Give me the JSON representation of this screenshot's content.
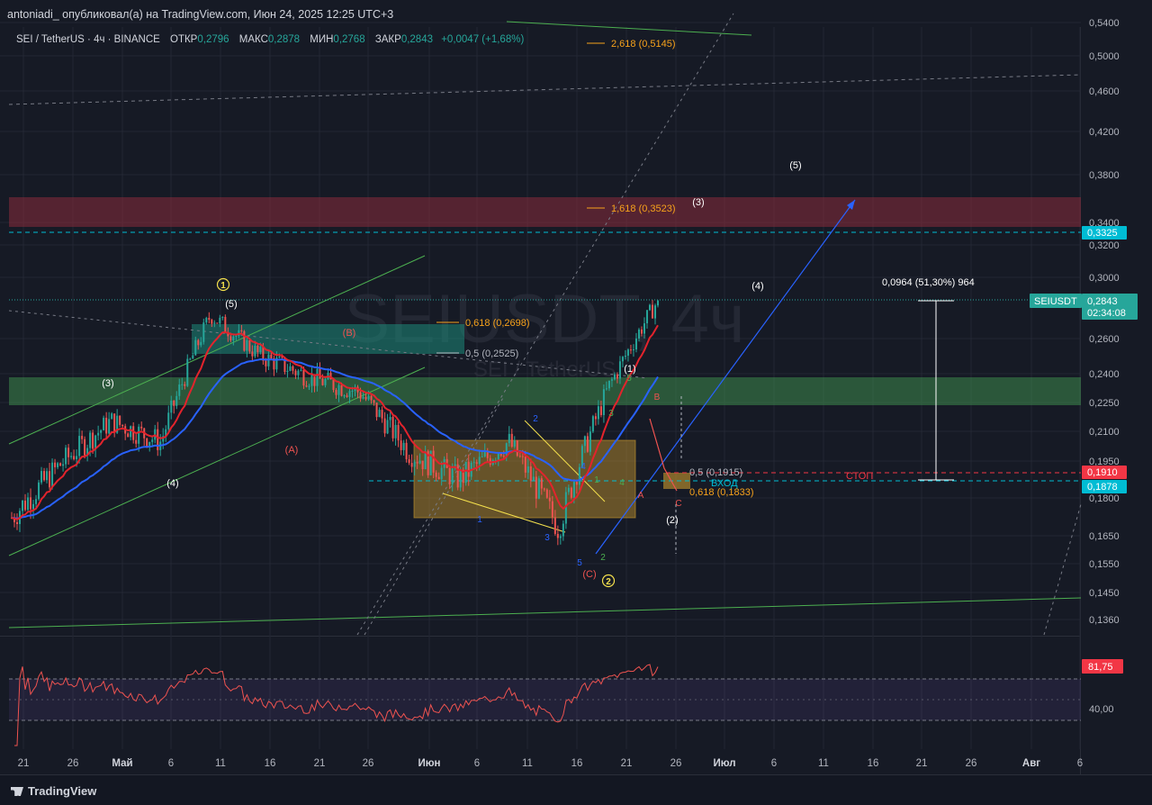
{
  "publisher": "antoniadi_ опубликовал(а) на TradingView.com, Июн 24, 2025 12:25 UTC+3",
  "brand": "TradingView",
  "legend": {
    "symbol": "SEI / TetherUS · 4ч · BINANCE",
    "open_label": "ОТКР",
    "open": "0,2796",
    "high_label": "МАКС",
    "high": "0,2878",
    "low_label": "МИН",
    "low": "0,2768",
    "close_label": "ЗАКР",
    "close": "0,2843",
    "change": "+0,0047 (+1,68%)"
  },
  "watermark": {
    "symbol": "SEIUSDT, 4ч",
    "name": "SEI / TetherUS"
  },
  "colors": {
    "up": "#26a69a",
    "down": "#ef5350",
    "ema_fast": "#e3232c",
    "ema_slow": "#2962ff",
    "fib": "#f7a21b",
    "resistance_zone": "#7a2a3a",
    "support_zone": "#2e6b3b",
    "rsi": "#ef5350",
    "level_cyan": "#00bcd4",
    "stop": "#f23645"
  },
  "price_axis": {
    "ticks": [
      "0,5400",
      "0,5000",
      "0,4600",
      "0,4200",
      "0,3800",
      "0,3400",
      "0,3200",
      "0,3000",
      "0,2600",
      "0,2400",
      "0,2250",
      "0,2100",
      "0,1950",
      "0,1800",
      "0,1650",
      "0,1550",
      "0,1450",
      "0,1360"
    ],
    "badges": {
      "level_top": "0,3325",
      "last_symbol": "SEIUSDT",
      "last_price": "0,2843",
      "countdown": "02:34:08",
      "stop": "0,1910",
      "entry": "0,1878"
    }
  },
  "rsi_axis": {
    "value": "81,75",
    "tick": "40,00"
  },
  "time_axis": [
    "21",
    "26",
    "Май",
    "6",
    "11",
    "16",
    "21",
    "26",
    "Июн",
    "6",
    "11",
    "16",
    "21",
    "26",
    "Июл",
    "6",
    "11",
    "16",
    "21",
    "26",
    "Авг",
    "6"
  ],
  "annotations": {
    "fib_2618": "2,618 (0,5145)",
    "fib_1618": "1,618 (0,3523)",
    "fib_0618_upper": "0,618 (0,2698)",
    "fib_05_upper": "0,5 (0,2525)",
    "fib_05_lower": "0,5 (0,1915)",
    "fib_0618_lower": "0,618 (0,1833)",
    "measure": "0,0964 (51,30%) 964",
    "stop": "СТОП",
    "entry": "ВХОД",
    "wave_1_circled": "1",
    "wave_2_circled": "2",
    "w_3": "(3)",
    "w_4": "(4)",
    "w_5": "(5)",
    "w_A": "(A)",
    "w_B": "(B)",
    "w_C": "(C)",
    "w_paren_1": "(1)",
    "w_paren_2": "(2)",
    "w_paren_3_proj": "(3)",
    "w_paren_4_proj": "(4)",
    "w_paren_5_proj": "(5)",
    "sub_1": "1",
    "sub_2": "2",
    "sub_3": "3",
    "sub_4": "4",
    "sub_5": "5",
    "g_1": "1",
    "g_2": "2",
    "g_3": "3",
    "g_4": "4",
    "g_5": "5",
    "abc_A": "A",
    "abc_B": "B",
    "abc_C": "C"
  },
  "chart_data": {
    "type": "line",
    "title": "SEI / TetherUS · 4ч · BINANCE",
    "xlabel": "",
    "ylabel": "",
    "ylim": [
      0.136,
      0.54
    ],
    "log_scale": true,
    "x": [
      "2025-04-21",
      "2025-04-26",
      "2025-05-01",
      "2025-05-06",
      "2025-05-11",
      "2025-05-16",
      "2025-05-21",
      "2025-05-26",
      "2025-06-01",
      "2025-06-06",
      "2025-06-11",
      "2025-06-16",
      "2025-06-21",
      "2025-06-24"
    ],
    "series": [
      {
        "values": [
          0.172,
          0.195,
          0.215,
          0.205,
          0.275,
          0.25,
          0.238,
          0.23,
          0.2,
          0.188,
          0.205,
          0.168,
          0.232,
          0.2843
        ]
      }
    ],
    "last_price": 0.2843,
    "levels": {
      "resistance_zone": [
        0.336,
        0.362
      ],
      "support_zone": [
        0.223,
        0.24
      ],
      "stop": 0.191,
      "entry": 0.1878,
      "level": 0.3325
    },
    "rsi_last": 81.75
  }
}
